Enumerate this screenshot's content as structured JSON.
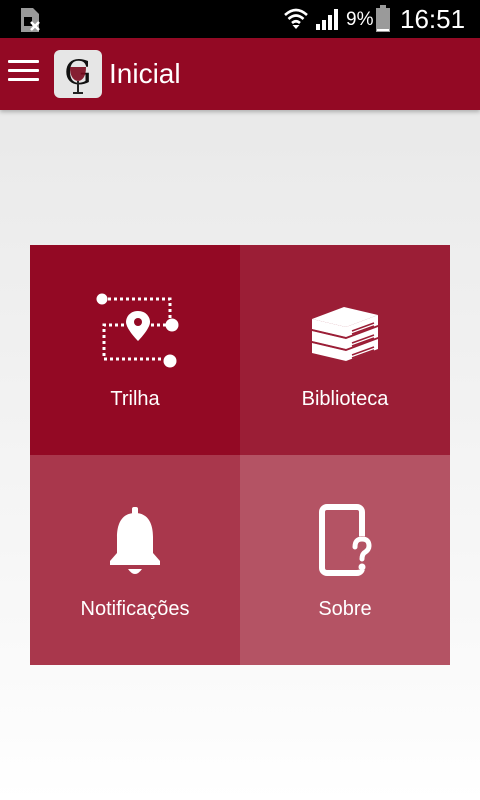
{
  "status_bar": {
    "battery_percent": "9%",
    "time": "16:51",
    "icons": [
      "sim-error-icon",
      "wifi-icon",
      "signal-icon",
      "battery-icon"
    ]
  },
  "app_bar": {
    "title": "Inicial",
    "logo_letter": "G",
    "color": "#930924"
  },
  "menu": {
    "tiles": [
      {
        "label": "Trilha",
        "icon": "trail-map-icon",
        "color": "#930924"
      },
      {
        "label": "Biblioteca",
        "icon": "books-icon",
        "color": "#9b1e36"
      },
      {
        "label": "Notificações",
        "icon": "bell-icon",
        "color": "#a9374c"
      },
      {
        "label": "Sobre",
        "icon": "phone-help-icon",
        "color": "#b45364"
      }
    ]
  }
}
